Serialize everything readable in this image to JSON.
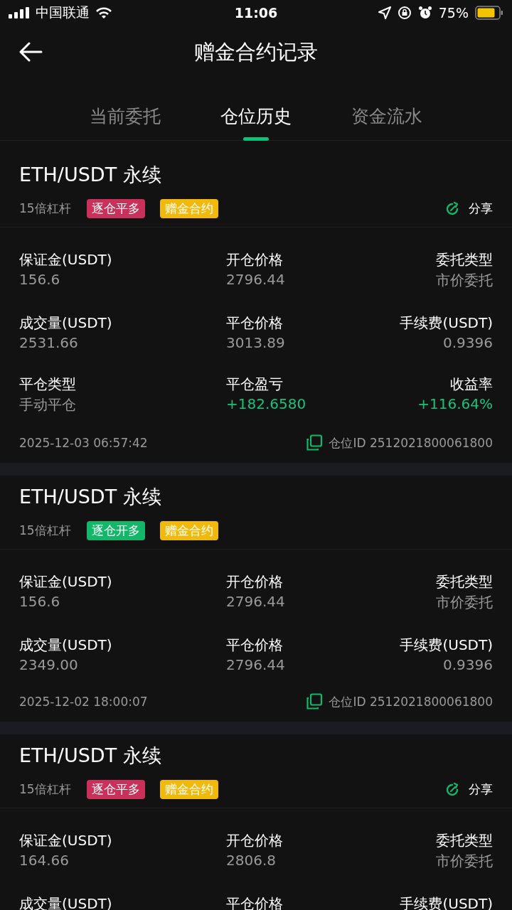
{
  "status_bar": {
    "carrier": "中国联通",
    "time": "11:06",
    "battery": "75%"
  },
  "header": {
    "title": "赠金合约记录"
  },
  "tabs": [
    {
      "label": "当前委托",
      "selected": false
    },
    {
      "label": "仓位历史",
      "selected": true
    },
    {
      "label": "资金流水",
      "selected": false
    }
  ],
  "positions": [
    {
      "title": "ETH/USDT 永续",
      "leverage": "15倍杠杆",
      "tags": [
        {
          "label": "逐仓平多",
          "color": "#c9305a"
        },
        {
          "label": "赠金合约",
          "color": "#f0b90b"
        }
      ],
      "share": {
        "label": "分享"
      },
      "fields": [
        {
          "label": "保证金(USDT)",
          "value": "156.6",
          "positive": false
        },
        {
          "label": "开仓价格",
          "value": "2796.44",
          "positive": false
        },
        {
          "label": "委托类型",
          "value": "市价委托",
          "positive": false
        },
        {
          "label": "成交量(USDT)",
          "value": "2531.66",
          "positive": false
        },
        {
          "label": "平仓价格",
          "value": "3013.89",
          "positive": false
        },
        {
          "label": "手续费(USDT)",
          "value": "0.9396",
          "positive": false
        },
        {
          "label": "平仓类型",
          "value": "手动平仓",
          "positive": false
        },
        {
          "label": "平仓盈亏",
          "value": "+182.6580",
          "positive": true
        },
        {
          "label": "收益率",
          "value": "+116.64%",
          "positive": true
        }
      ],
      "time": "2025-12-03 06:57:42",
      "position_id": "仓位ID 2512021800061800"
    },
    {
      "title": "ETH/USDT 永续",
      "leverage": "15倍杠杆",
      "tags": [
        {
          "label": "逐仓开多",
          "color": "#12b76a"
        },
        {
          "label": "赠金合约",
          "color": "#f0b90b"
        }
      ],
      "fields": [
        {
          "label": "保证金(USDT)",
          "value": "156.6",
          "positive": false
        },
        {
          "label": "开仓价格",
          "value": "2796.44",
          "positive": false
        },
        {
          "label": "委托类型",
          "value": "市价委托",
          "positive": false
        },
        {
          "label": "成交量(USDT)",
          "value": "2349.00",
          "positive": false
        },
        {
          "label": "平仓价格",
          "value": "2796.44",
          "positive": false
        },
        {
          "label": "手续费(USDT)",
          "value": "0.9396",
          "positive": false
        }
      ],
      "time": "2025-12-02 18:00:07",
      "position_id": "仓位ID 2512021800061800"
    },
    {
      "title": "ETH/USDT 永续",
      "leverage": "15倍杠杆",
      "tags": [
        {
          "label": "逐仓平多",
          "color": "#c9305a"
        },
        {
          "label": "赠金合约",
          "color": "#f0b90b"
        }
      ],
      "share": {
        "label": "分享"
      },
      "fields": [
        {
          "label": "保证金(USDT)",
          "value": "164.66",
          "positive": false
        },
        {
          "label": "开仓价格",
          "value": "2806.8",
          "positive": false
        },
        {
          "label": "委托类型",
          "value": "市价委托",
          "positive": false
        },
        {
          "label": "成交量(USDT)"
        },
        {
          "label": "平仓价格"
        },
        {
          "label": "手续费(USDT)"
        }
      ]
    }
  ]
}
